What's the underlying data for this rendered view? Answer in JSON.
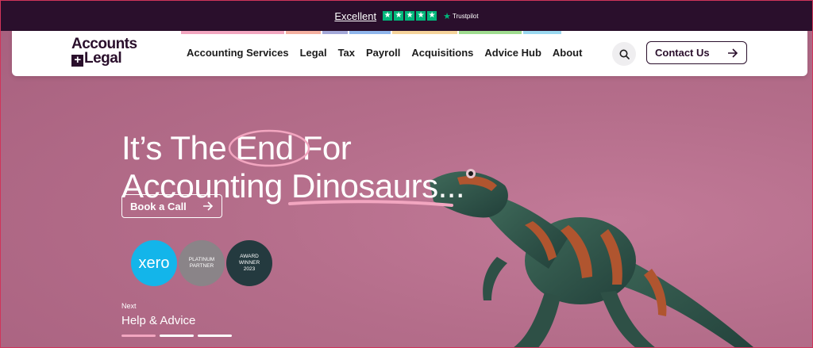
{
  "trustpilot": {
    "rating_text": "Excellent",
    "brand": "Trustpilot",
    "stars": 5,
    "star_color": "#00b67a"
  },
  "logo": {
    "line1": "Accounts",
    "line2": "Legal",
    "color": "#2a0f2c"
  },
  "nav": {
    "links": [
      "Accounting Services",
      "Legal",
      "Tax",
      "Payroll",
      "Acquisitions",
      "Advice Hub",
      "About"
    ],
    "strip_colors": [
      "#f2a6c0",
      "#f4b0a0",
      "#a3a8d8",
      "#8fb6ec",
      "#f5d39a",
      "#9fdc8f",
      "#9ad8f0"
    ],
    "search_icon": "search-icon",
    "contact_label": "Contact Us"
  },
  "hero": {
    "headline_1a": "It’s The",
    "headline_1b": "End",
    "headline_1c": "For",
    "headline_2a": "Accounting",
    "headline_2b": "Dinosaurs",
    "headline_2c": "...",
    "cta_label": "Book a Call",
    "accent_color": "#f2a6c0",
    "background_color": "#b8708e"
  },
  "badges": {
    "xero": "xero",
    "platinum_1": "PLATINUM",
    "platinum_2": "PARTNER",
    "award_1": "AWARD",
    "award_2": "WINNER",
    "award_3": "2023"
  },
  "slider": {
    "next_label": "Next",
    "next_title": "Help & Advice",
    "active_index": 0,
    "count": 3
  }
}
